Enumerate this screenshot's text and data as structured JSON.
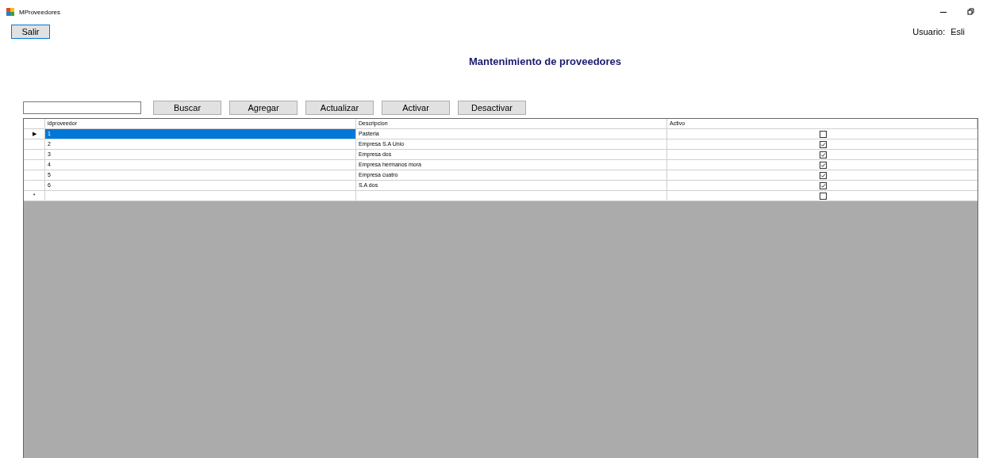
{
  "window": {
    "title": "MProveedores"
  },
  "exit_button": "Salir",
  "user": {
    "label": "Usuario:",
    "name": "Esli"
  },
  "heading": "Mantenimiento de proveedores",
  "buttons": [
    "Buscar",
    "Agregar",
    "Actualizar",
    "Activar",
    "Desactivar"
  ],
  "table": {
    "columns": [
      "idproveedor",
      "Descripcion",
      "Activo"
    ],
    "rows": [
      {
        "marker": "▶",
        "id": "1",
        "descripcion": "Pasteria",
        "activo": false,
        "selected": true
      },
      {
        "id": "2",
        "descripcion": "Empresa S.A Unio",
        "activo": true,
        "selected": false
      },
      {
        "id": "3",
        "descripcion": "Empresa dos",
        "activo": true,
        "selected": false
      },
      {
        "id": "4",
        "descripcion": "Empresa hermanos mora",
        "activo": true,
        "selected": false
      },
      {
        "id": "5",
        "descripcion": "Empresa cuatro",
        "activo": true,
        "selected": false
      },
      {
        "id": "6",
        "descripcion": "S.A dos",
        "activo": true,
        "selected": false
      }
    ],
    "new_row": {
      "marker": "*",
      "activo": false
    }
  }
}
